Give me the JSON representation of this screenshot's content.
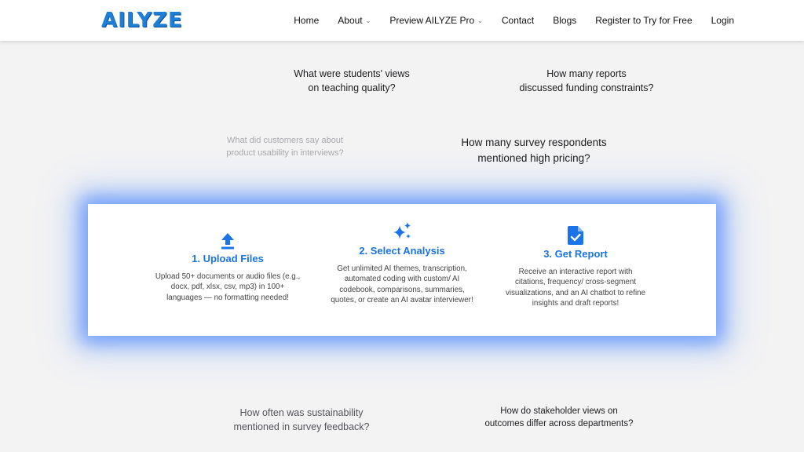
{
  "nav": {
    "logo_text": "AILYZE",
    "items": [
      {
        "label": "Home",
        "has_caret": false
      },
      {
        "label": "About",
        "has_caret": true
      },
      {
        "label": "Preview AILYZE Pro",
        "has_caret": true
      },
      {
        "label": "Contact",
        "has_caret": false
      },
      {
        "label": "Blogs",
        "has_caret": false
      },
      {
        "label": "Register to Try for Free",
        "has_caret": false
      },
      {
        "label": "Login",
        "has_caret": false
      }
    ],
    "caret_glyph": "⌄"
  },
  "questions": {
    "q1": {
      "line1": "What were students' views",
      "line2": "on teaching quality?"
    },
    "q2": {
      "line1": "How many reports",
      "line2": "discussed funding constraints?"
    },
    "q3": {
      "line1": "What did customers say about",
      "line2": "product usability in interviews?"
    },
    "q4": {
      "line1": "How many survey respondents",
      "line2": "mentioned high pricing?"
    },
    "q5": {
      "line1": "How often was sustainability",
      "line2": "mentioned in survey feedback?"
    },
    "q6": {
      "line1": "How do stakeholder views on",
      "line2": "outcomes differ across departments?"
    }
  },
  "steps": [
    {
      "icon": "upload-arrow-icon",
      "title": "1. Upload Files",
      "description": "Upload 50+ documents or audio files (e.g., docx, pdf, xlsx, csv, mp3) in 100+ languages — no formatting needed!"
    },
    {
      "icon": "sparkles-icon",
      "title": "2. Select Analysis",
      "description": "Get unlimited AI themes, transcription, automated coding with custom/ AI codebook, comparisons, summaries, quotes, or create an AI avatar interviewer!"
    },
    {
      "icon": "document-check-icon",
      "title": "3. Get Report",
      "description": "Receive an interactive report with citations, frequency/ cross-segment visualizations, and an AI chatbot to refine insights and draft reports!"
    }
  ],
  "colors": {
    "accent": "#1a73e8",
    "glow": "#2f6dff",
    "background": "#f3f3f4"
  }
}
